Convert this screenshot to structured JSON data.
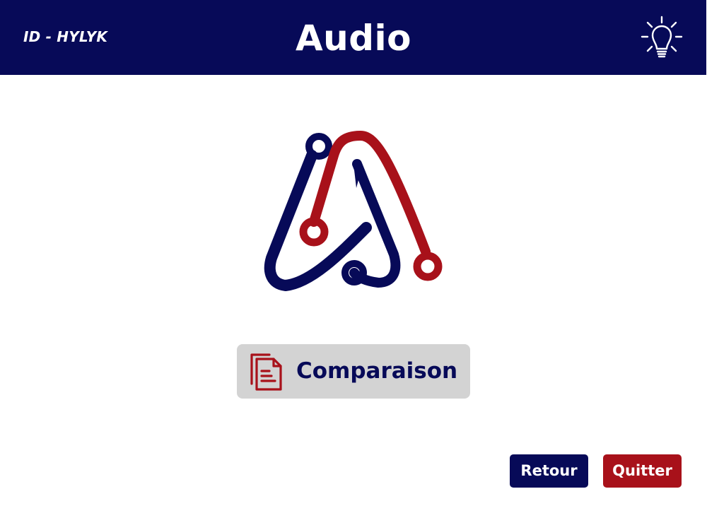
{
  "header": {
    "app_id": "ID - HYLYK",
    "title": "Audio",
    "hint_icon": "lightbulb-icon"
  },
  "logo": {
    "icon": "audio-logo-icon"
  },
  "main": {
    "compare_button": {
      "label": "Comparaison",
      "icon": "document-copy-icon"
    }
  },
  "footer": {
    "back_label": "Retour",
    "quit_label": "Quitter"
  },
  "colors": {
    "navy": "#070a58",
    "red": "#a8111a",
    "button_gray": "#d3d3d3",
    "white": "#ffffff"
  }
}
